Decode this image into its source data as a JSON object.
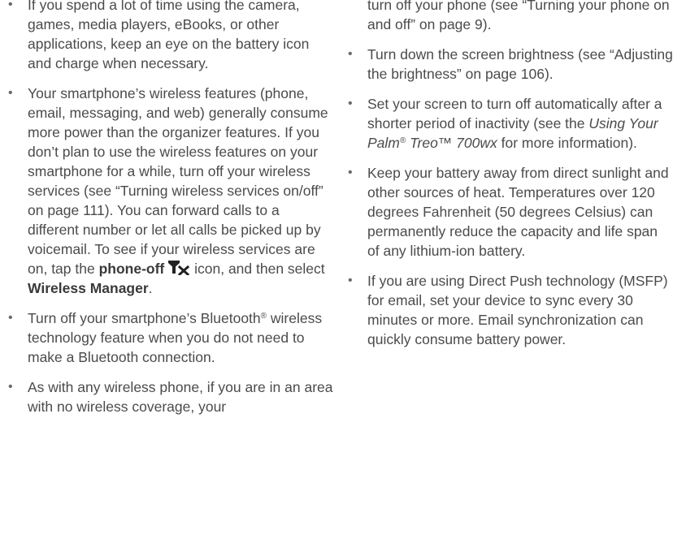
{
  "left_column": {
    "item1": "If you spend a lot of time using the camera, games, media players, eBooks, or other applications, keep an eye on the battery icon and charge when necessary.",
    "item2_a": "Your smartphone’s wireless features (phone, email, messaging, and web) generally consume more power than the organizer features. If you don’t plan to use the wireless features on your smartphone for a while, turn off your wireless services (see “Turning wireless services on/off” on page 111). You can forward calls to a different number or let all calls be picked up by voicemail. To see if your wireless services are on, tap the ",
    "item2_bold1": "phone-off",
    "item2_b": " icon, and then select ",
    "item2_bold2": "Wireless Manager",
    "item2_c": ".",
    "item3_a": "Turn off your smartphone’s Bluetooth",
    "item3_sup": "®",
    "item3_b": " wireless technology feature when you do not need to make a Bluetooth connection.",
    "item4": "As with any wireless phone, if you are in an area with no wireless coverage, your"
  },
  "right_column": {
    "item0": "turn off your phone (see “Turning your phone on and off” on page 9).",
    "item1": "Turn down the screen brightness (see “Adjusting the brightness” on page 106).",
    "item2_a": "Set your screen to turn off automatically after a shorter period of inactivity (see the ",
    "item2_italic_a": "Using Your Palm",
    "item2_sup": "®",
    "item2_italic_b": " Treo™ 700wx",
    "item2_b": " for more information).",
    "item3": "Keep your battery away from direct sunlight and other sources of heat. Temperatures over 120 degrees Fahrenheit (50 degrees Celsius) can permanently reduce the capacity and life span of any lithium-ion battery.",
    "item4": "If you are using Direct Push technology (MSFP) for email, set your device to sync every 30 minutes or more. Email synchronization can quickly consume battery power."
  },
  "icons": {
    "phone_off": "phone-off-icon"
  },
  "colors": {
    "text": "#4b4b4b",
    "bold": "#3a3a3a",
    "icon": "#222222"
  }
}
